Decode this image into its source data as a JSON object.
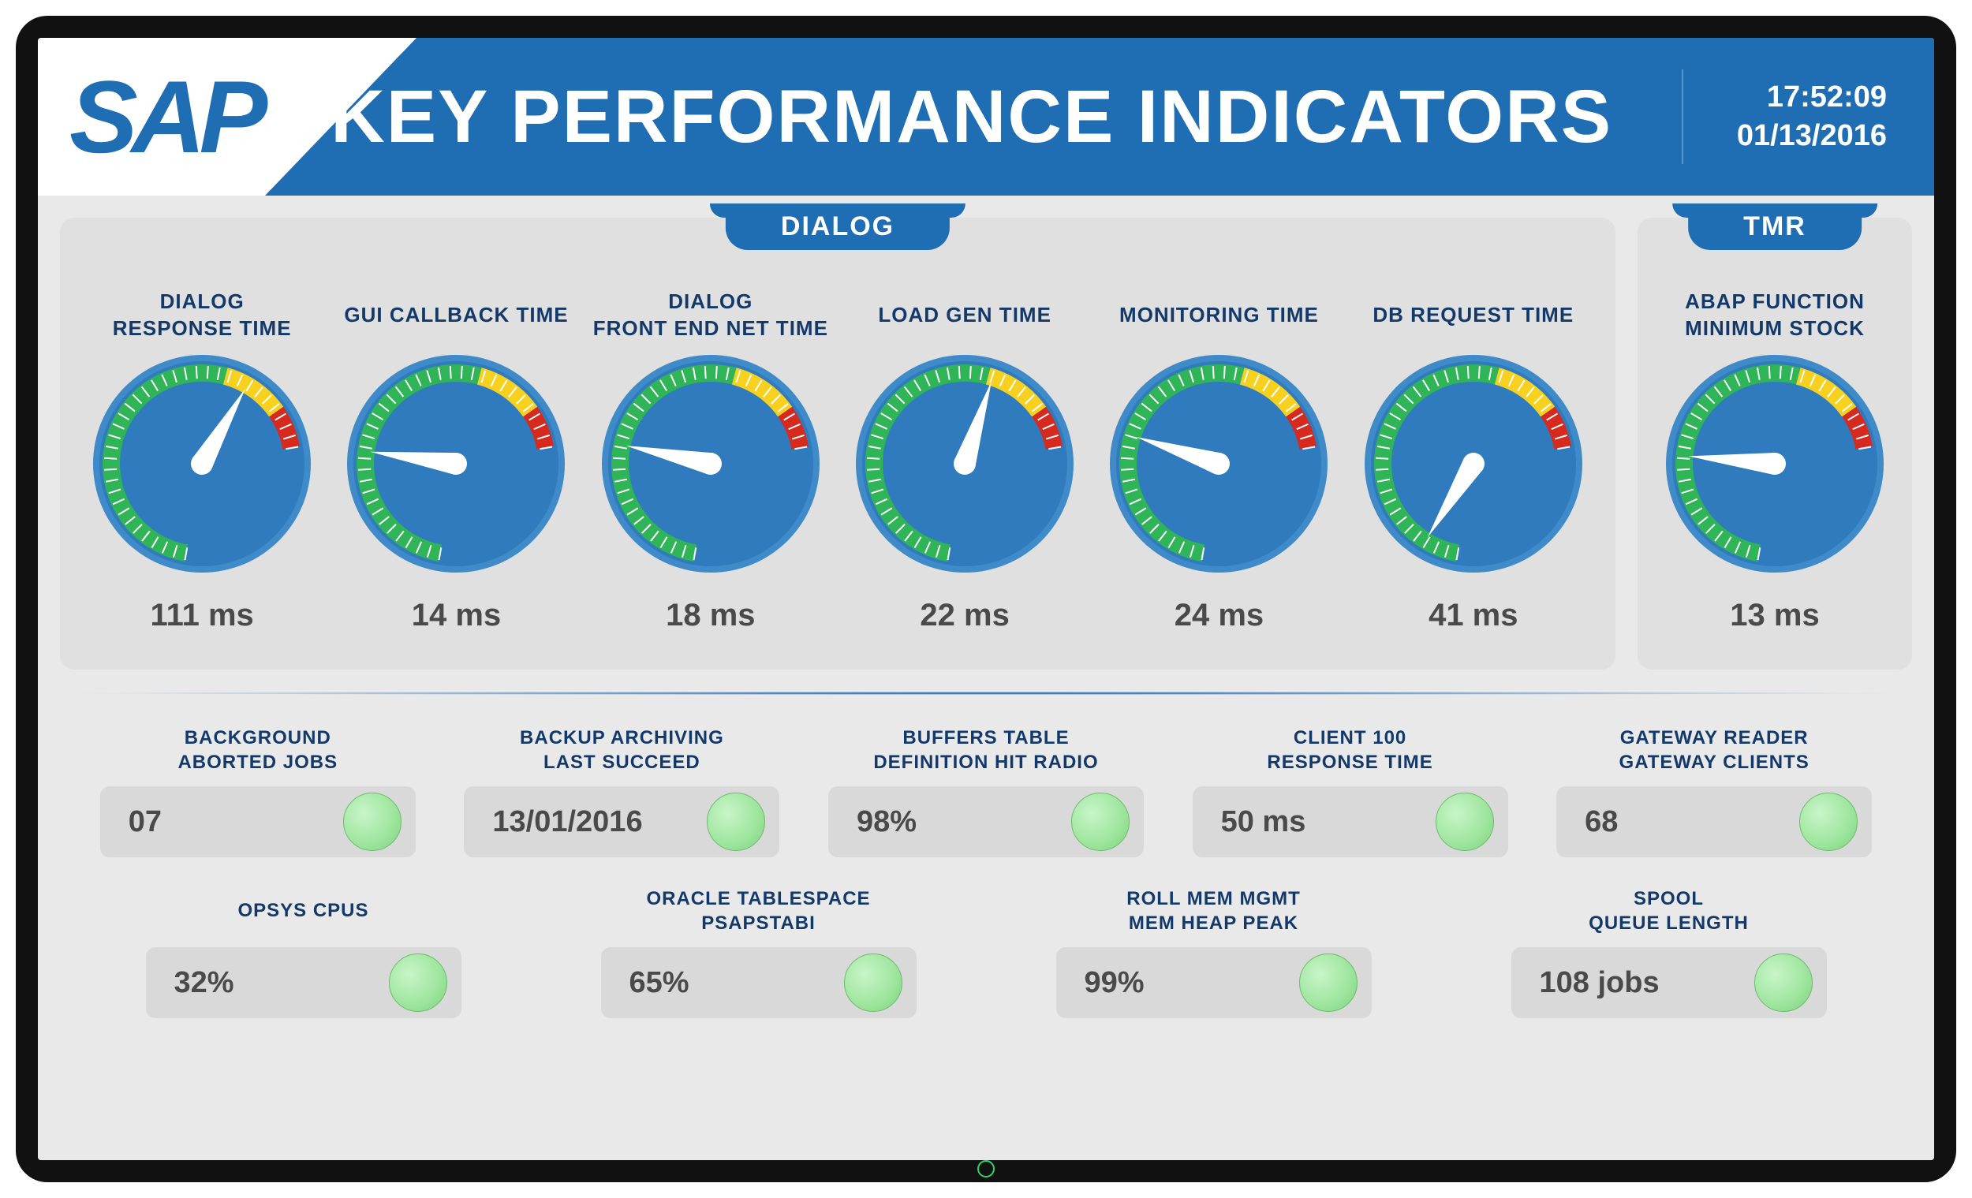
{
  "header": {
    "logo": "SAP",
    "title": "KEY PERFORMANCE INDICATORS",
    "time": "17:52:09",
    "date": "01/13/2016"
  },
  "dialog_panel": {
    "tab": "DIALOG",
    "gauges": [
      {
        "title": "DIALOG\nRESPONSE TIME",
        "value_text": "111 ms",
        "needle_angle": 30
      },
      {
        "title": "GUI CALLBACK TIME",
        "value_text": "14 ms",
        "needle_angle": -82
      },
      {
        "title": "DIALOG\nFRONT END NET TIME",
        "value_text": "18 ms",
        "needle_angle": -78
      },
      {
        "title": "LOAD GEN TIME",
        "value_text": "22 ms",
        "needle_angle": 18
      },
      {
        "title": "MONITORING TIME",
        "value_text": "24 ms",
        "needle_angle": -72
      },
      {
        "title": "DB REQUEST TIME",
        "value_text": "41 ms",
        "needle_angle": -148
      }
    ]
  },
  "tmr_panel": {
    "tab": "TMR",
    "gauges": [
      {
        "title": "ABAP FUNCTION\nMINIMUM STOCK",
        "value_text": "13 ms",
        "needle_angle": -85
      }
    ]
  },
  "stats_row1": [
    {
      "title": "BACKGROUND\nABORTED JOBS",
      "value": "07",
      "status": "ok"
    },
    {
      "title": "BACKUP ARCHIVING\nLAST SUCCEED",
      "value": "13/01/2016",
      "status": "ok"
    },
    {
      "title": "BUFFERS TABLE\nDEFINITION HIT RADIO",
      "value": "98%",
      "status": "ok"
    },
    {
      "title": "CLIENT 100\nRESPONSE TIME",
      "value": "50 ms",
      "status": "ok"
    },
    {
      "title": "GATEWAY READER\nGATEWAY CLIENTS",
      "value": "68",
      "status": "ok"
    }
  ],
  "stats_row2": [
    {
      "title": "OPSYS CPUS",
      "value": "32%",
      "status": "ok"
    },
    {
      "title": "ORACLE TABLESPACE\nPSAPSTABI",
      "value": "65%",
      "status": "ok"
    },
    {
      "title": "ROLL MEM MGMT\nMEM HEAP PEAK",
      "value": "99%",
      "status": "ok"
    },
    {
      "title": "SPOOL\nQUEUE LENGTH",
      "value": "108 jobs",
      "status": "ok"
    }
  ],
  "chart_data": {
    "type": "gauge",
    "description": "Seven radial gauges with green/yellow/red arc (approx -170° to 80°). Needle angle is degrees from 12-o'clock, clockwise positive.",
    "arc_range_deg": [
      -170,
      80
    ],
    "zones": [
      {
        "name": "green",
        "range_deg": [
          -170,
          15
        ],
        "color": "#2fb457"
      },
      {
        "name": "yellow",
        "range_deg": [
          15,
          55
        ],
        "color": "#f7d11e"
      },
      {
        "name": "red",
        "range_deg": [
          55,
          80
        ],
        "color": "#d62a1e"
      }
    ],
    "gauges": [
      {
        "panel": "DIALOG",
        "label": "DIALOG RESPONSE TIME",
        "value": 111,
        "unit": "ms",
        "needle_angle_deg": 30
      },
      {
        "panel": "DIALOG",
        "label": "GUI CALLBACK TIME",
        "value": 14,
        "unit": "ms",
        "needle_angle_deg": -82
      },
      {
        "panel": "DIALOG",
        "label": "DIALOG FRONT END NET TIME",
        "value": 18,
        "unit": "ms",
        "needle_angle_deg": -78
      },
      {
        "panel": "DIALOG",
        "label": "LOAD GEN TIME",
        "value": 22,
        "unit": "ms",
        "needle_angle_deg": 18
      },
      {
        "panel": "DIALOG",
        "label": "MONITORING TIME",
        "value": 24,
        "unit": "ms",
        "needle_angle_deg": -72
      },
      {
        "panel": "DIALOG",
        "label": "DB REQUEST TIME",
        "value": 41,
        "unit": "ms",
        "needle_angle_deg": -148
      },
      {
        "panel": "TMR",
        "label": "ABAP FUNCTION MINIMUM STOCK",
        "value": 13,
        "unit": "ms",
        "needle_angle_deg": -85
      }
    ]
  }
}
